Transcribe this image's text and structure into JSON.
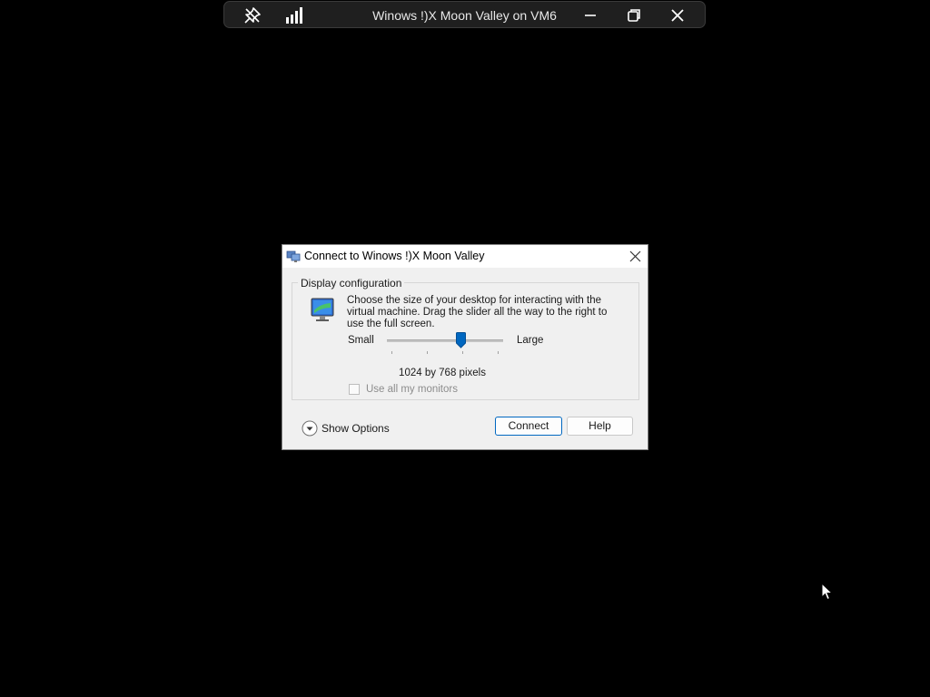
{
  "connection_bar": {
    "title": "Winows !)X Moon Valley on VM6",
    "icons": [
      "pin-icon",
      "signal-strength-icon",
      "minimize-icon",
      "restore-icon",
      "close-icon"
    ]
  },
  "dialog": {
    "title": "Connect to Winows !)X Moon Valley",
    "group_label": "Display configuration",
    "description": "Choose the size of your desktop for interacting with the virtual machine. Drag the slider all the way to the right to use the full screen.",
    "slider": {
      "min_label": "Small",
      "max_label": "Large",
      "position_fraction": 0.65
    },
    "resolution_text": "1024 by 768 pixels",
    "use_all_monitors": {
      "label": "Use all my monitors",
      "checked": false,
      "enabled": false
    },
    "show_options_label": "Show Options",
    "connect_label": "Connect",
    "help_label": "Help"
  },
  "colors": {
    "accent": "#0067c0",
    "background": "#000000",
    "dialog_bg": "#f0f0f0"
  }
}
